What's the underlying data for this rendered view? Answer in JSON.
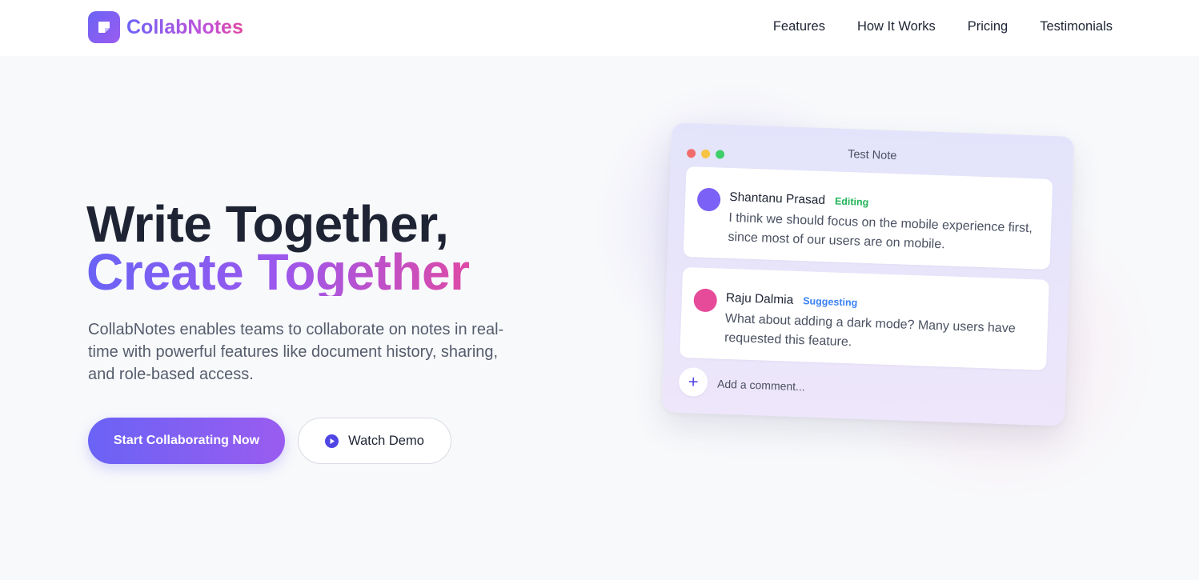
{
  "brand": {
    "name": "CollabNotes",
    "accent": "#6a63f5"
  },
  "nav": {
    "items": [
      "Features",
      "How It Works",
      "Pricing",
      "Testimonials"
    ]
  },
  "hero": {
    "title_line1": "Write Together,",
    "title_line2": "Create Together",
    "description": "CollabNotes enables teams to collaborate on notes in real-time with powerful features like document history, sharing, and role-based access.",
    "primary_cta": "Start Collaborating Now",
    "secondary_cta": "Watch Demo"
  },
  "note": {
    "title": "Test Note",
    "comments": [
      {
        "author": "Shantanu Prasad",
        "status": "Editing",
        "status_color": "#22b357",
        "avatar_color": "#7b61f5",
        "text": "I think we should focus on the mobile experience first, since most of our users are on mobile."
      },
      {
        "author": "Raju Dalmia",
        "status": "Suggesting",
        "status_color": "#3b82f6",
        "avatar_color": "#e64b9a",
        "text": "What about adding a dark mode? Many users have requested this feature."
      }
    ],
    "add_comment_placeholder": "Add a comment...",
    "add_button": "+"
  }
}
